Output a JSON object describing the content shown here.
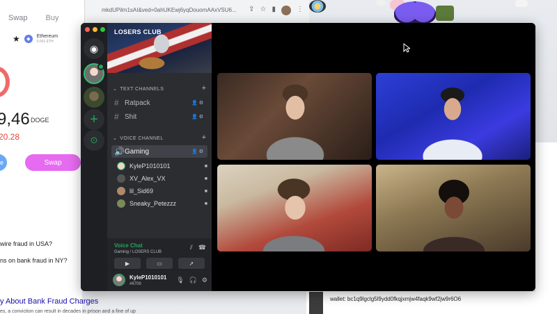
{
  "wallet": {
    "tabs": [
      "Swap",
      "Buy"
    ],
    "token": {
      "name": "Ethereum",
      "sub": "0.001 ETH"
    },
    "balance": "9,46",
    "unit": "DOGE",
    "change": "20.28",
    "swap_label": "Swap",
    "left_btn_label": "e"
  },
  "search_page": {
    "q1": "wire fraud in USA?",
    "q2": "ns on bank fraud in NY?",
    "result_title": "y About Bank Fraud Charges",
    "result_snippet": "es, a conviction can result in decades in prison and a fine of up"
  },
  "chrome": {
    "url": "mkdUPilm1sAI&ved=0ahUKEwj6yqDouomAAxVSU6..."
  },
  "right_page": {
    "wallet_addr": "wallet: bc1q9lgclg5l9ydd0fkqjxmjw4faqk9wf2jw9r6O6"
  },
  "discord": {
    "server_name": "LOSERS CLUB",
    "categories": {
      "text": "TEXT CHANNELS",
      "voice": "VOICE CHANNEL"
    },
    "text_channels": [
      {
        "name": "Ratpack"
      },
      {
        "name": "Shit"
      }
    ],
    "voice_channel": {
      "name": "Gaming"
    },
    "voice_users": [
      {
        "name": "KyleP1010101",
        "color": "#e8d6c6"
      },
      {
        "name": "XV_Alex_VX",
        "color": "#555555"
      },
      {
        "name": "lil_Sid69",
        "color": "#b08a6a"
      },
      {
        "name": "Sneaky_Petezzz",
        "color": "#7a8a5a"
      }
    ],
    "voice_panel": {
      "title": "Voice Chat",
      "sub": "Gaming / LOSERS CLUB"
    },
    "me": {
      "name": "KyleP1010101",
      "tag": "#6709"
    },
    "colors": {
      "green": "#23a55a",
      "rail": "#1e1f22",
      "sidebar": "#2b2d31"
    },
    "icons": [
      "discord-icon",
      "plus-icon",
      "compass-icon",
      "mic-icon",
      "headphones-icon",
      "gear-icon",
      "camera-icon",
      "screen-share-icon",
      "rocket-icon"
    ]
  }
}
